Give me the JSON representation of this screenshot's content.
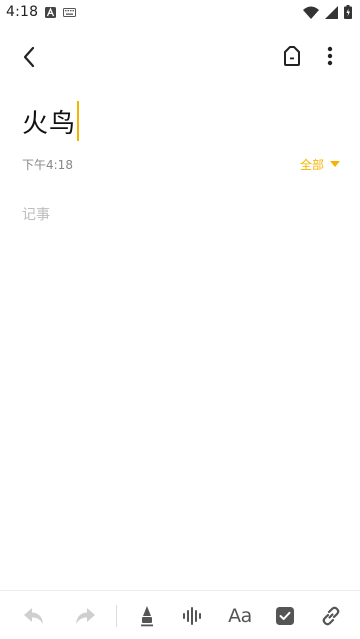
{
  "status_bar": {
    "time": "4:18",
    "icons": [
      "a-letter-icon",
      "keyboard-icon",
      "wifi-icon",
      "signal-icon",
      "battery-icon"
    ]
  },
  "app_bar": {
    "back_icon": "chevron-left-icon",
    "tag_icon": "tag-icon",
    "more_icon": "more-vert-icon"
  },
  "note": {
    "title": "火鸟",
    "timestamp": "下午4:18",
    "folder": "全部",
    "body_placeholder": "记事"
  },
  "toolbar": {
    "items": [
      "undo-icon",
      "redo-icon",
      "pen-icon",
      "voice-icon",
      "text-format-icon",
      "checkbox-icon",
      "link-icon"
    ],
    "text_format_label": "Aa"
  },
  "colors": {
    "accent": "#f5b400",
    "icon_dark": "#555555",
    "icon_disabled": "#cfcfcf",
    "placeholder": "#bdbdbd",
    "meta_text": "#888888"
  }
}
